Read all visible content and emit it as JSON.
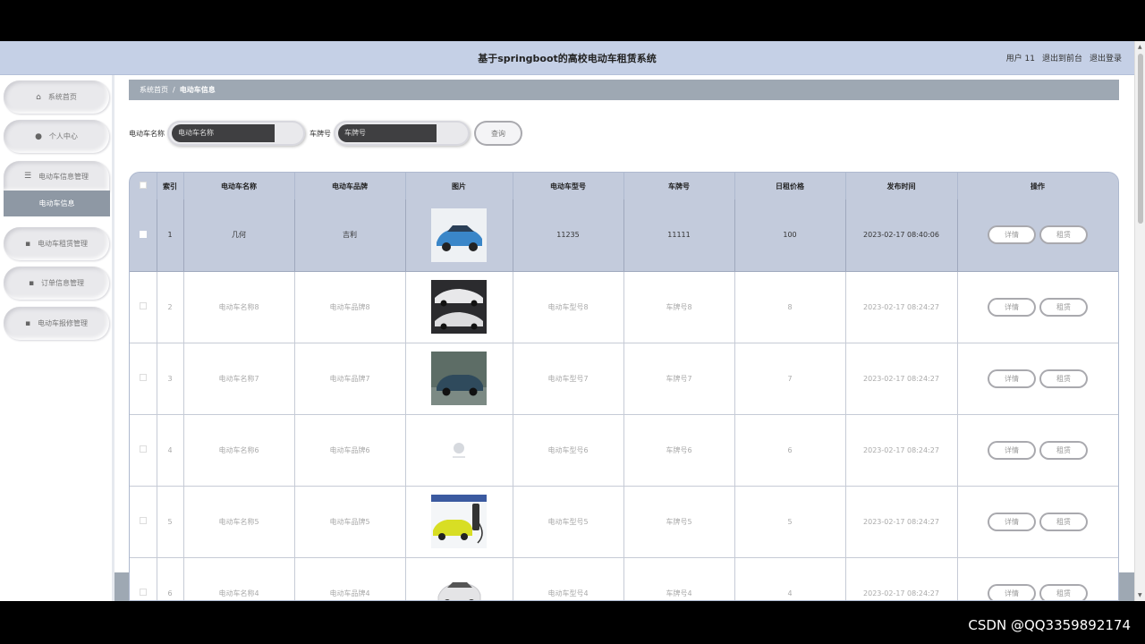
{
  "header": {
    "title": "基于springboot的高校电动车租赁系统",
    "user_label": "用户 11",
    "back_label": "退出到前台",
    "logout_label": "退出登录"
  },
  "sidebar": {
    "items": [
      {
        "label": "系统首页",
        "icon": "home-icon"
      },
      {
        "label": "个人中心",
        "icon": "user-icon"
      },
      {
        "label": "电动车信息管理",
        "icon": "list-icon"
      },
      {
        "label": "电动车租赁管理",
        "icon": "grid-icon"
      },
      {
        "label": "订单信息管理",
        "icon": "grid-icon"
      },
      {
        "label": "电动车报修管理",
        "icon": "grid-icon"
      }
    ],
    "sub_item": "电动车信息"
  },
  "breadcrumb": {
    "home": "系统首页",
    "sep": "/",
    "current": "电动车信息"
  },
  "search": {
    "name_label": "电动车名称",
    "name_placeholder": "电动车名称",
    "plate_label": "车牌号",
    "plate_placeholder": "车牌号",
    "button": "查询"
  },
  "table": {
    "headers": [
      "索引",
      "电动车名称",
      "电动车品牌",
      "图片",
      "电动车型号",
      "车牌号",
      "日租价格",
      "发布时间",
      "操作"
    ],
    "detail_label": "详情",
    "rent_label": "租赁",
    "rows": [
      {
        "index": "1",
        "name": "几何",
        "brand": "吉利",
        "model": "11235",
        "plate": "11111",
        "price": "100",
        "time": "2023-02-17 08:40:06",
        "image": "blue-suv"
      },
      {
        "index": "2",
        "name": "电动车名称8",
        "brand": "电动车品牌8",
        "model": "电动车型号8",
        "plate": "车牌号8",
        "price": "8",
        "time": "2023-02-17 08:24:27",
        "image": "white-sedan"
      },
      {
        "index": "3",
        "name": "电动车名称7",
        "brand": "电动车品牌7",
        "model": "电动车型号7",
        "plate": "车牌号7",
        "price": "7",
        "time": "2023-02-17 08:24:27",
        "image": "dark-suv"
      },
      {
        "index": "4",
        "name": "电动车名称6",
        "brand": "电动车品牌6",
        "model": "电动车型号6",
        "plate": "车牌号6",
        "price": "6",
        "time": "2023-02-17 08:24:27",
        "image": "logo"
      },
      {
        "index": "5",
        "name": "电动车名称5",
        "brand": "电动车品牌5",
        "model": "电动车型号5",
        "plate": "车牌号5",
        "price": "5",
        "time": "2023-02-17 08:24:27",
        "image": "yellow-car"
      },
      {
        "index": "6",
        "name": "电动车名称4",
        "brand": "电动车品牌4",
        "model": "电动车型号4",
        "plate": "车牌号4",
        "price": "4",
        "time": "2023-02-17 08:24:27",
        "image": "white-mini"
      }
    ]
  },
  "watermark": "CSDN @QQ3359892174",
  "colors": {
    "header_bg": "#c5d0e6",
    "breadcrumb_bg": "#9ea8b3",
    "selected_row": "#c3cbdc"
  }
}
